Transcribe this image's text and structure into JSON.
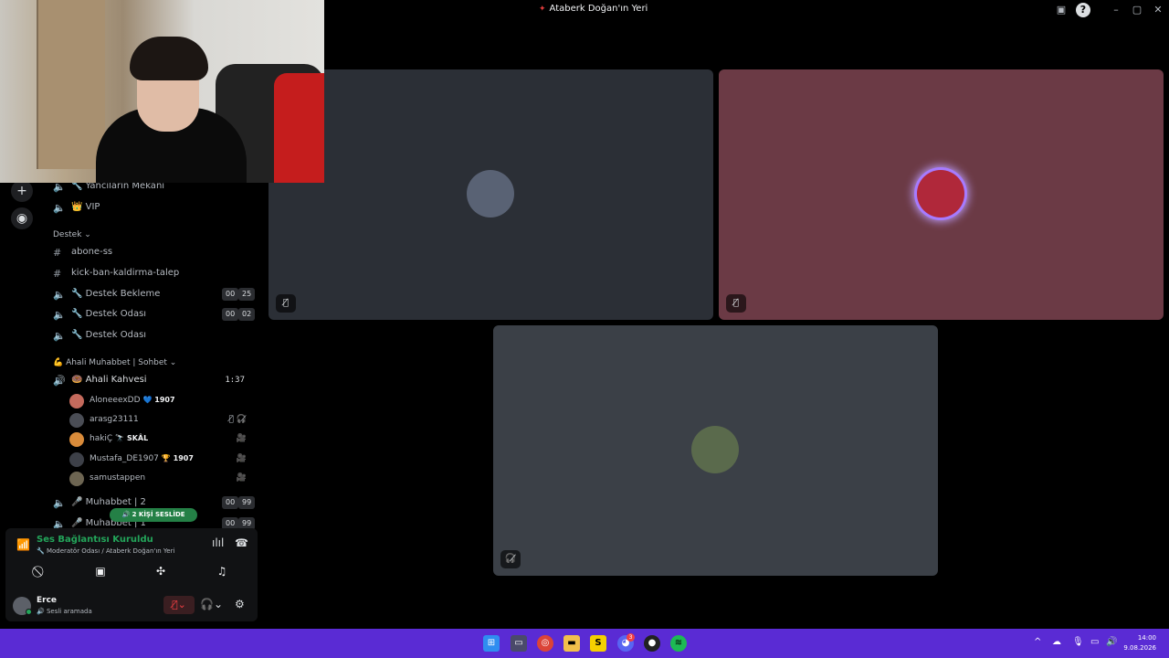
{
  "window": {
    "title": "Ataberk Doğan'ın Yeri"
  },
  "colors": {
    "accent": "#23a55a",
    "danger": "#f23f43",
    "taskbar": "#5a2bd4",
    "tile_dark": "#2b2f36",
    "tile_red": "#6b3a45",
    "tile_gray": "#3b4047"
  },
  "channels": {
    "yancilar": "🔧 Yancıların Mekanı",
    "vip": "👑 VIP",
    "destek_cat": "Destek ⌄",
    "abone": "abone-ss",
    "kick": "kick-ban-kaldirma-talep",
    "destek_bekleme": "🔧 Destek Bekleme",
    "destek_bekleme_a": "00",
    "destek_bekleme_b": "25",
    "destek_odasi1": "🔧 Destek Odası",
    "destek_odasi1_a": "00",
    "destek_odasi1_b": "02",
    "destek_odasi2": "🔧 Destek Odası",
    "ahali_cat": "💪 Ahali Muhabbet | Sohbet ⌄",
    "ahali_kahvesi": "🍩 Ahali Kahvesi",
    "ahali_timer": "1:37",
    "muhabbet2": "🎤 Muhabbet | 2",
    "muhabbet2_a": "00",
    "muhabbet2_b": "99",
    "muhabbet1": "🎤 Muhabbet | 1",
    "muhabbet1_a": "00",
    "muhabbet1_b": "99"
  },
  "users": [
    {
      "name": "AloneeexDD",
      "tag": "💙 1907",
      "status": ""
    },
    {
      "name": "arasg23111",
      "tag": "",
      "status": "🎙̸ 🎧̸"
    },
    {
      "name": "hakiÇ",
      "tag": "🔭 SKÂL",
      "status": "🎥"
    },
    {
      "name": "Mustafa_DE1907",
      "tag": "🏆 1907",
      "status": "🎥"
    },
    {
      "name": "samustappen",
      "tag": "",
      "status": "🎥"
    }
  ],
  "pill": "🔊 2 KİŞİ SESLİDE",
  "voice": {
    "title": "Ses Bağlantısı Kuruldu",
    "subtitle": "🔧 Moderatör Odası / Ataberk Doğan'ın Yeri",
    "user": "Erce",
    "user_status": "🔊 Sesli aramada"
  },
  "clock": {
    "time": "14:00",
    "date": "9.08.2026"
  },
  "taskbar": {
    "discord_badge": "3"
  }
}
